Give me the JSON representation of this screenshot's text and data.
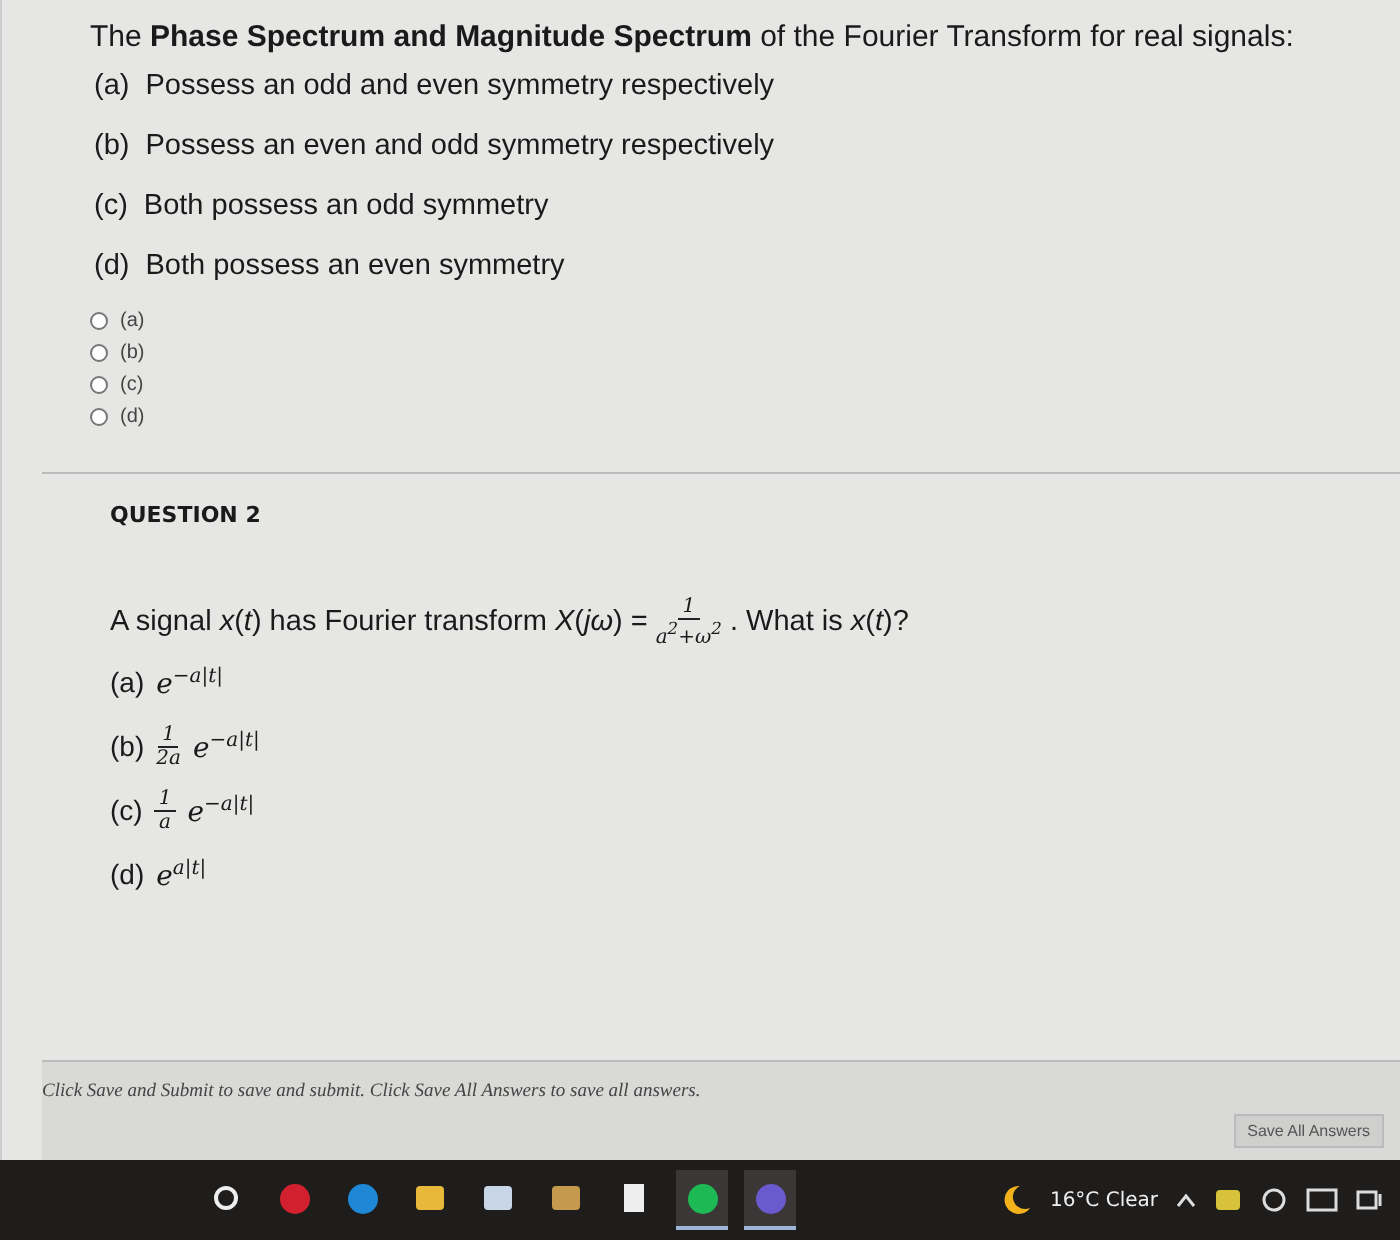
{
  "question1": {
    "stem": "The **Phase Spectrum and Magnitude Spectrum** of the Fourier Transform for real signals:",
    "statements": [
      {
        "label": "(a)",
        "text": "Possess an odd and even symmetry respectively"
      },
      {
        "label": "(b)",
        "text": "Possess an even and odd symmetry respectively"
      },
      {
        "label": "(c)",
        "text": "Both possess an odd symmetry"
      },
      {
        "label": "(d)",
        "text": "Both possess an even symmetry"
      }
    ],
    "choices": [
      {
        "label": "(a)",
        "selected": false
      },
      {
        "label": "(b)",
        "selected": false
      },
      {
        "label": "(c)",
        "selected": false
      },
      {
        "label": "(d)",
        "selected": false
      }
    ]
  },
  "question2": {
    "heading": "QUESTION 2",
    "stem_before": "A signal *x*(*t*) has Fourier transform *X*(*jω*) =",
    "stem_fraction": {
      "numerator": "1",
      "denominator": "a$^{2}$+ω$^{2}$"
    },
    "stem_after": ". What is *x*(*t*)?",
    "options": [
      {
        "label": "(a)",
        "base": "e",
        "exponent": "−a|t|"
      },
      {
        "label": "(b)",
        "fraction": {
          "numerator": "1",
          "denominator": "2a"
        },
        "base": "e",
        "exponent": "−a|t|"
      },
      {
        "label": "(c)",
        "fraction": {
          "numerator": "1",
          "denominator": "a"
        },
        "base": "e",
        "exponent": "−a|t|"
      },
      {
        "label": "(d)",
        "base": "e",
        "exponent": "a|t|"
      }
    ]
  },
  "footer": {
    "instructions": "Click Save and Submit to save and submit. Click Save All Answers to save all answers.",
    "save_button": "Save All Answers"
  },
  "taskbar": {
    "apps": [
      {
        "kind": "search",
        "running": false
      },
      {
        "kind": "opera",
        "running": false
      },
      {
        "kind": "edge",
        "running": false
      },
      {
        "kind": "explorer",
        "running": false
      },
      {
        "kind": "store",
        "running": false
      },
      {
        "kind": "basket",
        "running": false
      },
      {
        "kind": "file",
        "running": false
      },
      {
        "kind": "spotify",
        "running": true
      },
      {
        "kind": "chrome",
        "running": true
      }
    ],
    "weather": "16°C Clear"
  }
}
